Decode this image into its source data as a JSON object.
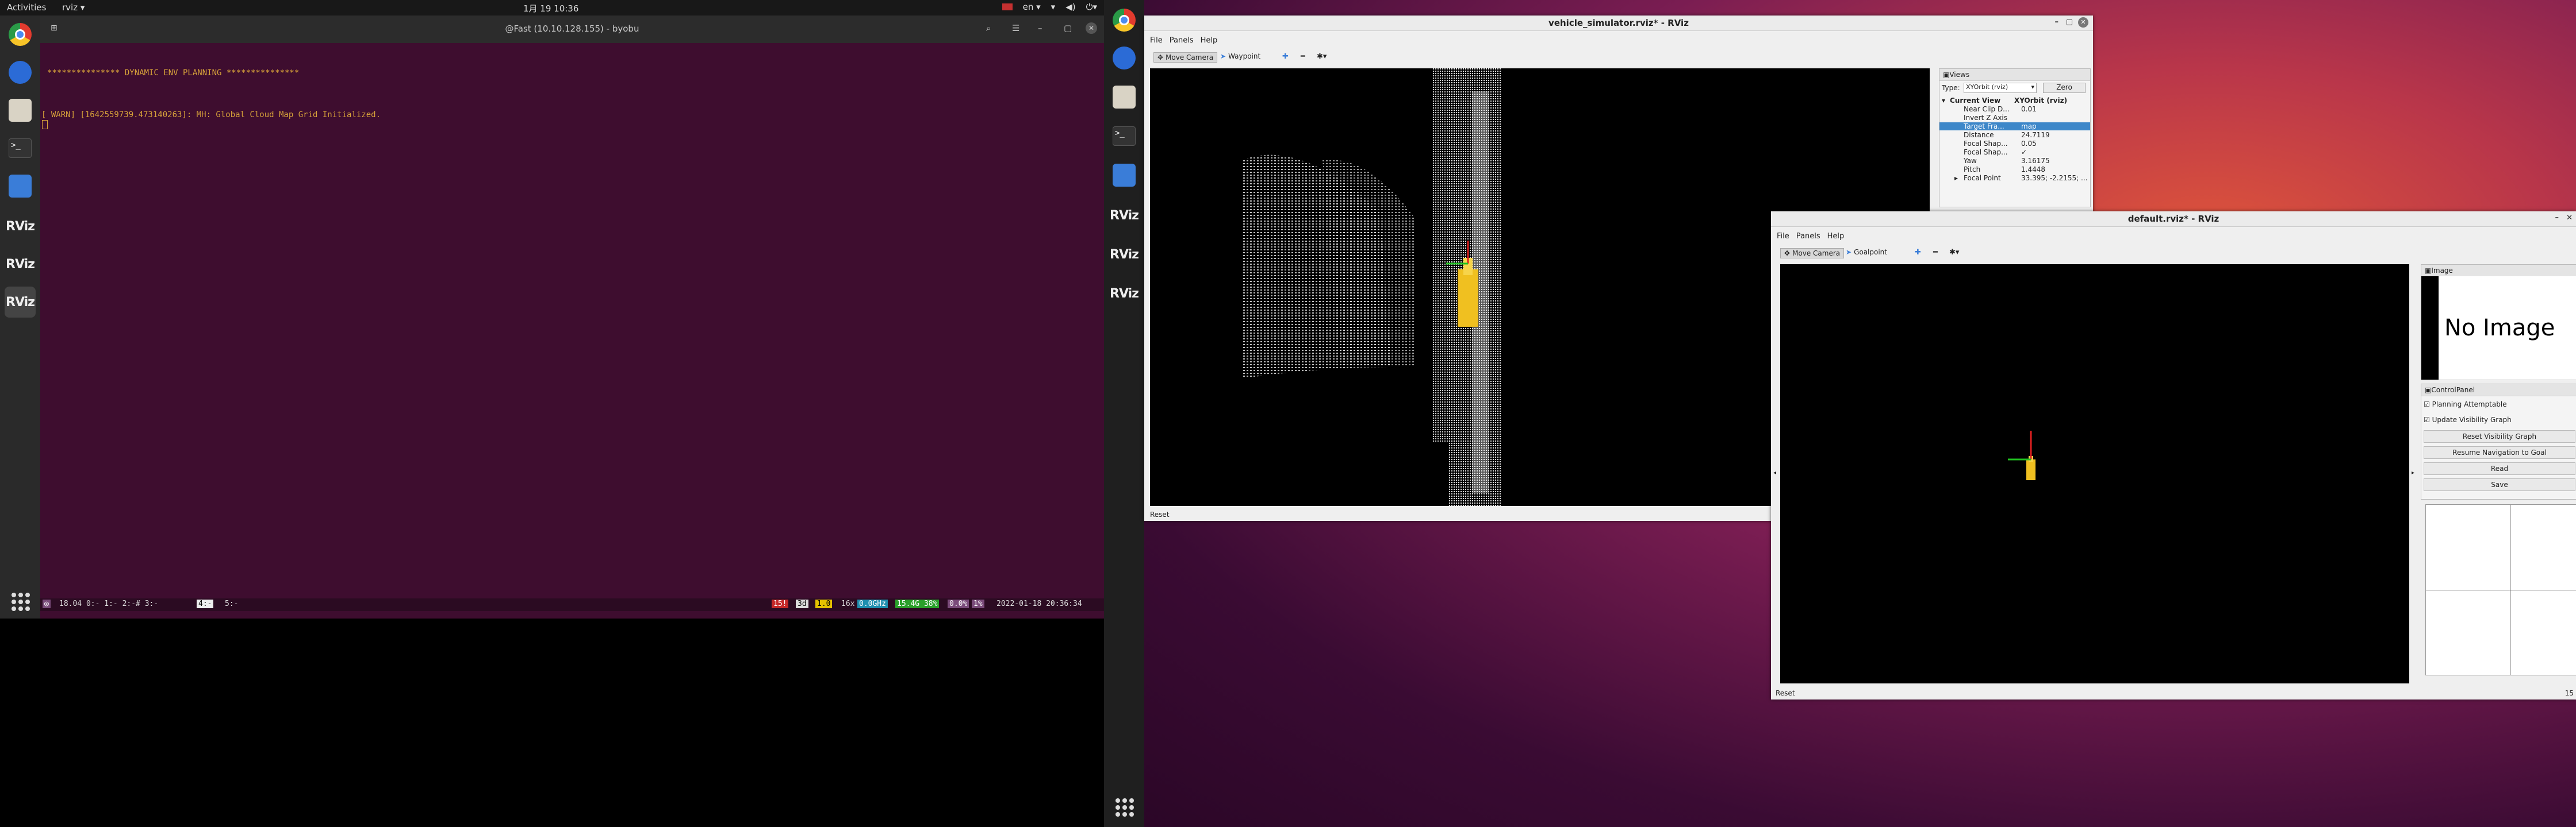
{
  "topbar": {
    "activities": "Activities",
    "app_menu": "rviz ▾",
    "clock": "1月 19 10:36",
    "lang": "en ▾"
  },
  "dock_left": {
    "items": [
      {
        "icon": "chrome-icon"
      },
      {
        "icon": "thunderbird-icon"
      },
      {
        "icon": "files-icon"
      },
      {
        "icon": "terminal-icon",
        "glyph": ">_"
      },
      {
        "icon": "text-editor-icon"
      },
      {
        "icon": "rviz-icon",
        "label": "RViz"
      },
      {
        "icon": "rviz-icon",
        "label": "RViz"
      },
      {
        "icon": "rviz-icon",
        "label": "RViz"
      }
    ]
  },
  "terminal": {
    "title": "@Fast (10.10.128.155) - byobu",
    "line1": "*************** DYNAMIC ENV PLANNING ***************",
    "line2": "[ WARN] [1642559739.473140263]: MH: Global Cloud Map Grid Initialized.",
    "status_left": "18.04 0:-  1:-  2:-# 3:-",
    "status_active": "4:-",
    "status_5": "5:-",
    "status_r1": "15!",
    "status_r2": "3d",
    "status_r3": "1.0",
    "status_r4": "16x",
    "status_r5": "0.0GHz",
    "status_r6": "15.4G 38%",
    "status_r7": "0.0%",
    "status_r8": "1%",
    "status_date": "2022-01-18 20:36:34"
  },
  "rviz1": {
    "title": "vehicle_simulator.rviz* - RViz",
    "menu": [
      "File",
      "Panels",
      "Help"
    ],
    "tools": {
      "move_camera": "Move Camera",
      "waypoint": "Waypoint"
    },
    "reset": "Reset",
    "views": {
      "header": "Views",
      "type_label": "Type:",
      "type_value": "XYOrbit (rviz)",
      "zero": "Zero",
      "rows": [
        {
          "k": "Current View",
          "v": "XYOrbit (rviz)"
        },
        {
          "k": "Near Clip D...",
          "v": "0.01"
        },
        {
          "k": "Invert Z Axis",
          "v": ""
        },
        {
          "k": "Target Fra...",
          "v": "map"
        },
        {
          "k": "Distance",
          "v": "24.7119"
        },
        {
          "k": "Focal Shap...",
          "v": "0.05"
        },
        {
          "k": "Focal Shap...",
          "v": "✓"
        },
        {
          "k": "Yaw",
          "v": "3.16175"
        },
        {
          "k": "Pitch",
          "v": "1.4448"
        },
        {
          "k": "Focal Point",
          "v": "33.395; -2.2155; ..."
        }
      ]
    }
  },
  "dock_right": {
    "items": [
      {
        "icon": "chrome-icon"
      },
      {
        "icon": "thunderbird-icon"
      },
      {
        "icon": "files-icon"
      },
      {
        "icon": "terminal-icon",
        "glyph": ">_"
      },
      {
        "icon": "text-editor-icon"
      },
      {
        "icon": "rviz-icon",
        "label": "RViz"
      },
      {
        "icon": "rviz-icon",
        "label": "RViz"
      },
      {
        "icon": "rviz-icon",
        "label": "RViz"
      }
    ]
  },
  "rviz2": {
    "title": "default.rviz* - RViz",
    "menu": [
      "File",
      "Panels",
      "Help"
    ],
    "tools": {
      "move_camera": "Move Camera",
      "goalpoint": "Goalpoint"
    },
    "reset": "Reset",
    "image_panel": {
      "header": "Image",
      "no_image": "No Image"
    },
    "control_panel": {
      "header": "ControlPanel",
      "planning_attemptable": "Planning Attemptable",
      "update_visibility_graph": "Update Visibility Graph",
      "reset_visibility_graph": "Reset Visibility Graph",
      "resume_navigation": "Resume Navigation to Goal",
      "read": "Read",
      "save": "Save"
    },
    "fps": "15"
  },
  "colors": {
    "terminal_bg": "#3e0d2f",
    "warn_text": "#d7a23a",
    "selection": "#3d87c9"
  }
}
